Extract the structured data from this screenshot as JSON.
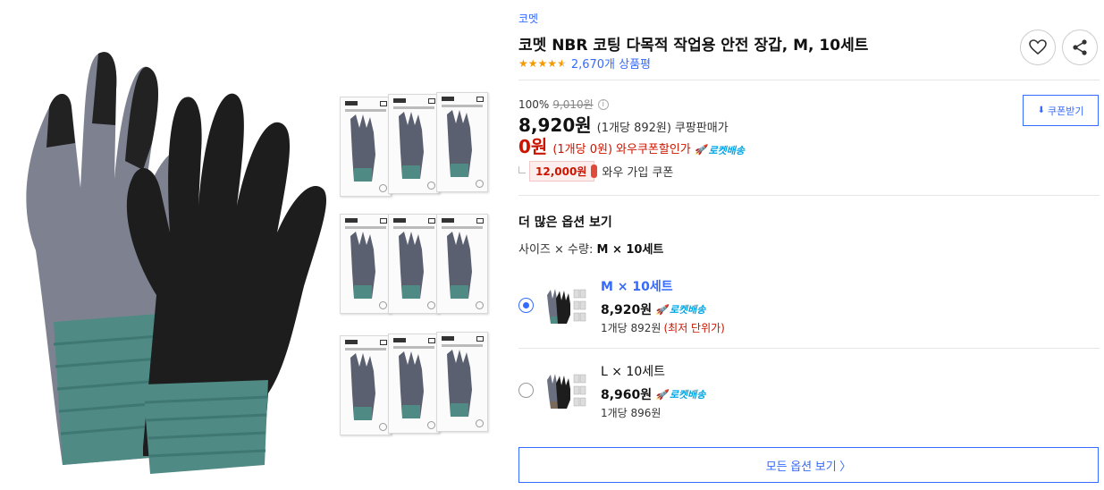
{
  "product": {
    "brand": "코멧",
    "title": "코멧 NBR 코팅 다목적 작업용 안전 장갑, M, 10세트",
    "rating": 4.5,
    "review_count": "2,670개 상품평"
  },
  "price": {
    "discount_rate": "100%",
    "original_price": "9,010원",
    "sale_price": "8,920원",
    "unit_price": "(1개당 892원)",
    "seller_label": "쿠팡판매가",
    "coupon_price": "0원",
    "coupon_unit_price": "(1개당 0원)",
    "coupon_label": "와우쿠폰할인가",
    "rocket_label": "로켓배송",
    "wow_coupon_amount": "12,000원",
    "wow_coupon_label": "와우 가입 쿠폰",
    "coupon_button": "쿠폰받기"
  },
  "options": {
    "section_title": "더 많은 옵션 보기",
    "summary_label": "사이즈 × 수량: ",
    "summary_value": "M × 10세트",
    "items": [
      {
        "name": "M × 10세트",
        "price": "8,920원",
        "rocket": "로켓배송",
        "unit": "1개당 892원",
        "lowest": "(최저 단위가)",
        "selected": true
      },
      {
        "name": "L × 10세트",
        "price": "8,960원",
        "rocket": "로켓배송",
        "unit": "1개당 896원",
        "lowest": "",
        "selected": false
      }
    ],
    "all_options_button": "모든 옵션 보기 〉"
  },
  "colors": {
    "accent_blue": "#346aff",
    "price_red": "#cb1400",
    "rocket_blue": "#00a5e5",
    "star_orange": "#f49a00"
  },
  "icons": [
    "heart-icon",
    "share-icon",
    "info-icon",
    "download-icon",
    "rocket-icon",
    "chevron-right-icon"
  ]
}
